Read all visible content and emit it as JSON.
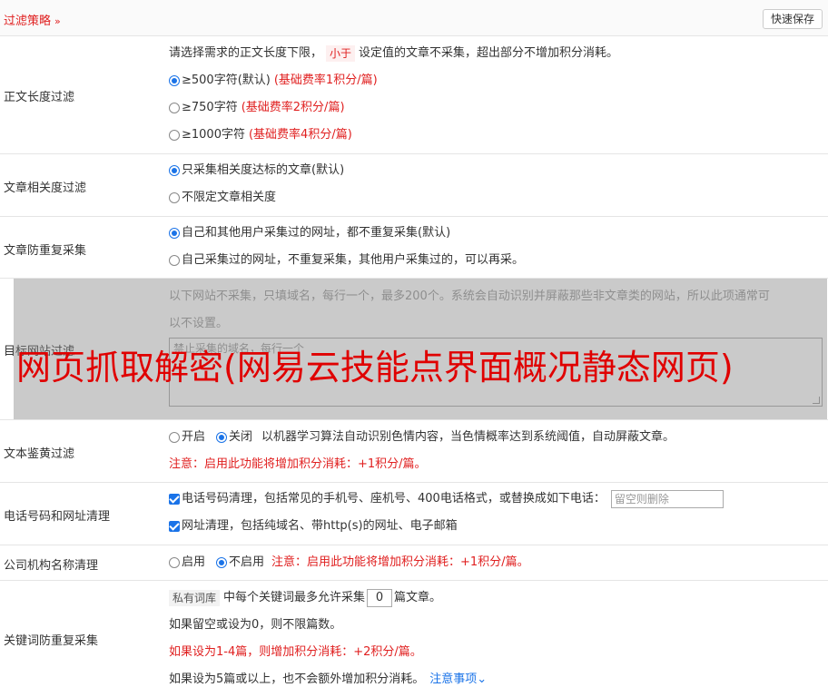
{
  "header": {
    "title": "过滤策略",
    "save_label": "快速保存"
  },
  "length_filter": {
    "label": "正文长度过滤",
    "desc_pre": "请选择需求的正文长度下限，",
    "desc_tag": "小于",
    "desc_post": "设定值的文章不采集，超出部分不增加积分消耗。",
    "options": [
      {
        "text": "≥500字符(默认)",
        "note": "(基础费率1积分/篇)",
        "checked": true
      },
      {
        "text": "≥750字符",
        "note": "(基础费率2积分/篇)",
        "checked": false
      },
      {
        "text": "≥1000字符",
        "note": "(基础费率4积分/篇)",
        "checked": false
      }
    ]
  },
  "relevance_filter": {
    "label": "文章相关度过滤",
    "options": [
      {
        "text": "只采集相关度达标的文章(默认)",
        "checked": true
      },
      {
        "text": "不限定文章相关度",
        "checked": false
      }
    ]
  },
  "dedupe": {
    "label": "文章防重复采集",
    "options": [
      {
        "text": "自己和其他用户采集过的网址，都不重复采集(默认)",
        "checked": true
      },
      {
        "text": "自己采集过的网址，不重复采集，其他用户采集过的，可以再采。",
        "checked": false
      }
    ]
  },
  "site_filter": {
    "label": "目标网站过滤",
    "desc_line1": "以下网站不采集，只填域名，每行一个，最多200个。系统会自动识别并屏蔽那些非文章类的网站，所以此项通常可",
    "desc_line2": "以不设置。",
    "placeholder": "禁止采集的域名，每行一个"
  },
  "watermark": "网页抓取解密(网易云技能点界面概况静态网页)",
  "porn_filter": {
    "label": "文本鉴黄过滤",
    "on_label": "开启",
    "off_label": "关闭",
    "desc": "以机器学习算法自动识别色情内容，当色情概率达到系统阈值，自动屏蔽文章。",
    "note": "注意：启用此功能将增加积分消耗：+1积分/篇。"
  },
  "phone_filter": {
    "label": "电话号码和网址清理",
    "phone_text": "电话号码清理，包括常见的手机号、座机号、400电话格式，或替换成如下电话：",
    "phone_placeholder": "留空则删除",
    "url_text": "网址清理，包括纯域名、带http(s)的网址、电子邮箱"
  },
  "org_filter": {
    "label": "公司机构名称清理",
    "on_label": "启用",
    "off_label": "不启用",
    "note": "注意：启用此功能将增加积分消耗：+1积分/篇。"
  },
  "keyword_dedupe": {
    "label": "关键词防重复采集",
    "tag": "私有词库",
    "line1_pre": "中每个关键词最多允许采集",
    "count": "0",
    "line1_post": "篇文章。",
    "line2": "如果留空或设为0，则不限篇数。",
    "line3": "如果设为1-4篇，则增加积分消耗：+2积分/篇。",
    "line4": "如果设为5篇或以上，也不会额外增加积分消耗。",
    "link": "注意事项"
  }
}
